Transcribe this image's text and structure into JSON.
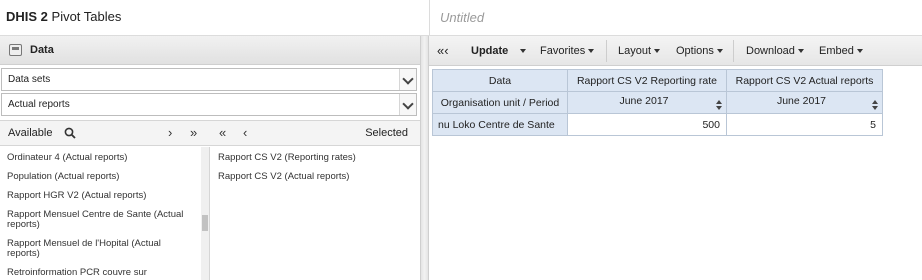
{
  "header": {
    "app_name_bold": "DHIS 2",
    "app_name_rest": " Pivot Tables",
    "favorite_title": "Untitled"
  },
  "data_panel": {
    "title": "Data",
    "data_type_select": "Data sets",
    "metric_select": "Actual reports",
    "available_label": "Available",
    "selected_label": "Selected",
    "nav": {
      "select_one": "›",
      "select_all": "»",
      "deselect_all": "«",
      "deselect_one": "‹"
    },
    "available_items": [
      "Ordinateur 4 (Actual reports)",
      "Population (Actual reports)",
      "Rapport HGR V2 (Actual reports)",
      "Rapport Mensuel Centre de Sante (Actual reports)",
      "Rapport Mensuel de l'Hopital (Actual reports)",
      "Retroinformation PCR couvre sur"
    ],
    "selected_items": [
      "Rapport CS V2 (Reporting rates)",
      "Rapport CS V2 (Actual reports)"
    ]
  },
  "toolbar": {
    "collapse": "«‹",
    "update": "Update",
    "favorites": "Favorites",
    "layout": "Layout",
    "options": "Options",
    "download": "Download",
    "embed": "Embed"
  },
  "pivot": {
    "corner_top": "Data",
    "corner_bottom": "Organisation unit / Period",
    "columns": [
      {
        "header": "Rapport CS V2 Reporting rate",
        "period": "June 2017"
      },
      {
        "header": "Rapport CS V2 Actual reports",
        "period": "June 2017"
      }
    ],
    "rows": [
      {
        "label": "nu Loko Centre de Sante",
        "values": [
          "500",
          "5"
        ]
      }
    ]
  }
}
